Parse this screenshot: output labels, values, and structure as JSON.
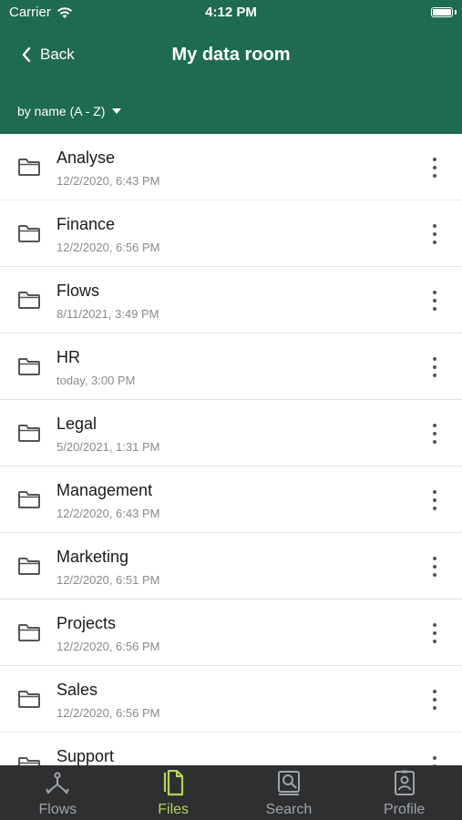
{
  "status": {
    "carrier": "Carrier",
    "time": "4:12 PM"
  },
  "nav": {
    "back_label": "Back",
    "title": "My data room"
  },
  "sort": {
    "label": "by name (A - Z)"
  },
  "folders": [
    {
      "name": "Analyse",
      "date": "12/2/2020, 6:43 PM"
    },
    {
      "name": "Finance",
      "date": "12/2/2020, 6:56 PM"
    },
    {
      "name": "Flows",
      "date": "8/11/2021, 3:49 PM"
    },
    {
      "name": "HR",
      "date": "today, 3:00 PM"
    },
    {
      "name": "Legal",
      "date": "5/20/2021, 1:31 PM"
    },
    {
      "name": "Management",
      "date": "12/2/2020, 6:43 PM"
    },
    {
      "name": "Marketing",
      "date": "12/2/2020, 6:51 PM"
    },
    {
      "name": "Projects",
      "date": "12/2/2020, 6:56 PM"
    },
    {
      "name": "Sales",
      "date": "12/2/2020, 6:56 PM"
    },
    {
      "name": "Support",
      "date": ""
    }
  ],
  "tabs": [
    {
      "label": "Flows",
      "icon": "flows-icon",
      "active": false
    },
    {
      "label": "Files",
      "icon": "files-icon",
      "active": true
    },
    {
      "label": "Search",
      "icon": "search-icon",
      "active": false
    },
    {
      "label": "Profile",
      "icon": "profile-icon",
      "active": false
    }
  ],
  "colors": {
    "header": "#1f6b4f",
    "tabbar": "#2d2f31",
    "active_tab": "#b9d25a",
    "inactive_tab": "#a0a3a6"
  }
}
